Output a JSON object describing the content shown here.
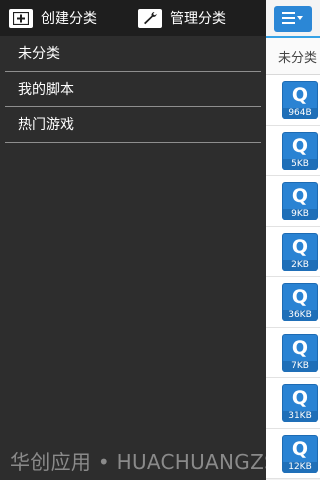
{
  "drawer": {
    "create_label": "创建分类",
    "manage_label": "管理分类",
    "categories": [
      {
        "label": "未分类"
      },
      {
        "label": "我的脚本"
      },
      {
        "label": "热门游戏"
      }
    ]
  },
  "main": {
    "subtitle": "未分类",
    "files": [
      {
        "icon_letter": "Q",
        "size": "964B"
      },
      {
        "icon_letter": "Q",
        "size": "5KB"
      },
      {
        "icon_letter": "Q",
        "size": "9KB"
      },
      {
        "icon_letter": "Q",
        "size": "2KB"
      },
      {
        "icon_letter": "Q",
        "size": "36KB"
      },
      {
        "icon_letter": "Q",
        "size": "7KB"
      },
      {
        "icon_letter": "Q",
        "size": "31KB"
      },
      {
        "icon_letter": "Q",
        "size": "12KB"
      }
    ]
  },
  "watermark": "华创应用 • HUACHUANGZS.COM",
  "colors": {
    "drawer_bg": "#2d2d2d",
    "topbar_bg": "#1e1e1e",
    "accent": "#2b87d6",
    "divider": "#8e8e8e"
  },
  "icons": {
    "create": "add-box-icon",
    "manage": "wrench-icon",
    "menu": "menu-dropdown-icon"
  }
}
